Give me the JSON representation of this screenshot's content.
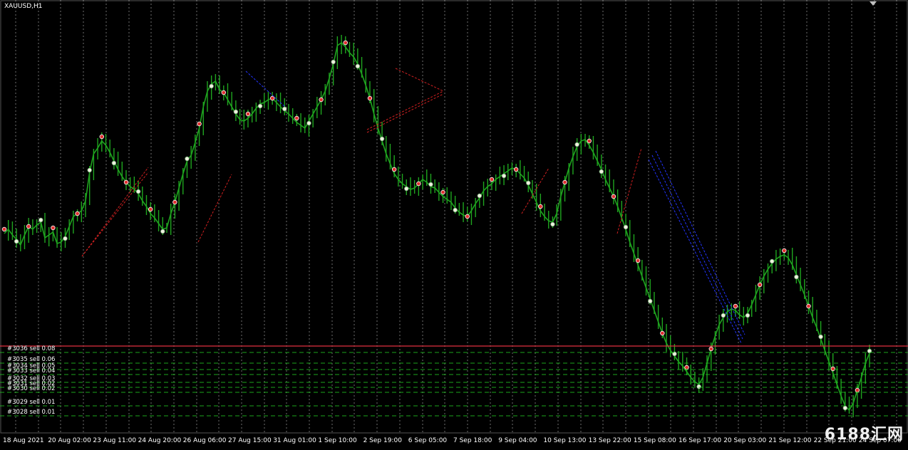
{
  "symbol": "XAUUSD,H1",
  "watermark": "6188汇网",
  "colors": {
    "background": "#000000",
    "bull_candle": "#1fa51f",
    "grid": "#c8c8c8",
    "sell_marker": "#e03030",
    "buy_marker": "#f0f0e0",
    "trend_line_red": "#d02020",
    "trend_line_blue": "#2233ff",
    "order_line": "#20c020",
    "price_line": "#e03040"
  },
  "chart_data": {
    "type": "line",
    "x_ticks": [
      "18 Aug 2021",
      "20 Aug 02:00",
      "23 Aug 11:00",
      "24 Aug 20:00",
      "26 Aug 06:00",
      "27 Aug 15:00",
      "31 Aug 01:00",
      "1 Sep 10:00",
      "2 Sep 19:00",
      "6 Sep 05:00",
      "7 Sep 18:00",
      "9 Sep 04:00",
      "10 Sep 13:00",
      "13 Sep 22:00",
      "15 Sep 08:00",
      "16 Sep 17:00",
      "20 Sep 03:00",
      "21 Sep 12:00",
      "22 Sep 21:00",
      "24 Sep 07:00"
    ],
    "series": [
      {
        "values": [
          328,
          322,
          330,
          336,
          344,
          330,
          318,
          322,
          316,
          312,
          334,
          330,
          326,
          342,
          340,
          332,
          318,
          304,
          300,
          296,
          282,
          242,
          216,
          208,
          198,
          204,
          214,
          226,
          238,
          248,
          256,
          262,
          266,
          272,
          282,
          290,
          300,
          306,
          314,
          322,
          320,
          300,
          284,
          264,
          244,
          226,
          218,
          200,
          180,
          150,
          128,
          118,
          114,
          126,
          130,
          140,
          150,
          160,
          168,
          170,
          166,
          160,
          152,
          146,
          144,
          140,
          138,
          144,
          150,
          156,
          160,
          166,
          172,
          176,
          180,
          170,
          160,
          150,
          140,
          128,
          110,
          90,
          64,
          60,
          66,
          74,
          80,
          90,
          104,
          120,
          138,
          160,
          180,
          198,
          216,
          230,
          244,
          252,
          258,
          262,
          266,
          264,
          258,
          252,
          256,
          262,
          264,
          270,
          276,
          280,
          284,
          292,
          298,
          302,
          304,
          296,
          286,
          278,
          268,
          262,
          258,
          252,
          248,
          244,
          240,
          236,
          238,
          244,
          250,
          260,
          272,
          284,
          296,
          304,
          310,
          312,
          300,
          276,
          256,
          236,
          220,
          206,
          198,
          196,
          204,
          214,
          226,
          238,
          252,
          264,
          276,
          290,
          306,
          322,
          340,
          356,
          372,
          388,
          404,
          420,
          436,
          452,
          468,
          482,
          492,
          500,
          508,
          514,
          522,
          530,
          536,
          540,
          530,
          510,
          490,
          472,
          456,
          446,
          438,
          434,
          436,
          442,
          446,
          440,
          428,
          414,
          400,
          388,
          378,
          370,
          364,
          360,
          358,
          362,
          372,
          386,
          400,
          414,
          430,
          446,
          460,
          476,
          492,
          508,
          524,
          540,
          556,
          570,
          576,
          566,
          548,
          530,
          510,
          496
        ],
        "ylim": [
          0,
          628
        ]
      }
    ],
    "orders": [
      {
        "label": "#3036 sell 0.08"
      },
      {
        "label": "#3035 sell 0.06"
      },
      {
        "label": "#3034 sell 0.05"
      },
      {
        "label": "#3033 sell 0.04"
      },
      {
        "label": "#3032 sell 0.03"
      },
      {
        "label": "#3031 sell 0.02"
      },
      {
        "label": "#3030 sell 0.02"
      },
      {
        "label": "#3029 sell 0.01"
      },
      {
        "label": "#3028 sell 0.01"
      }
    ],
    "grid": true
  }
}
